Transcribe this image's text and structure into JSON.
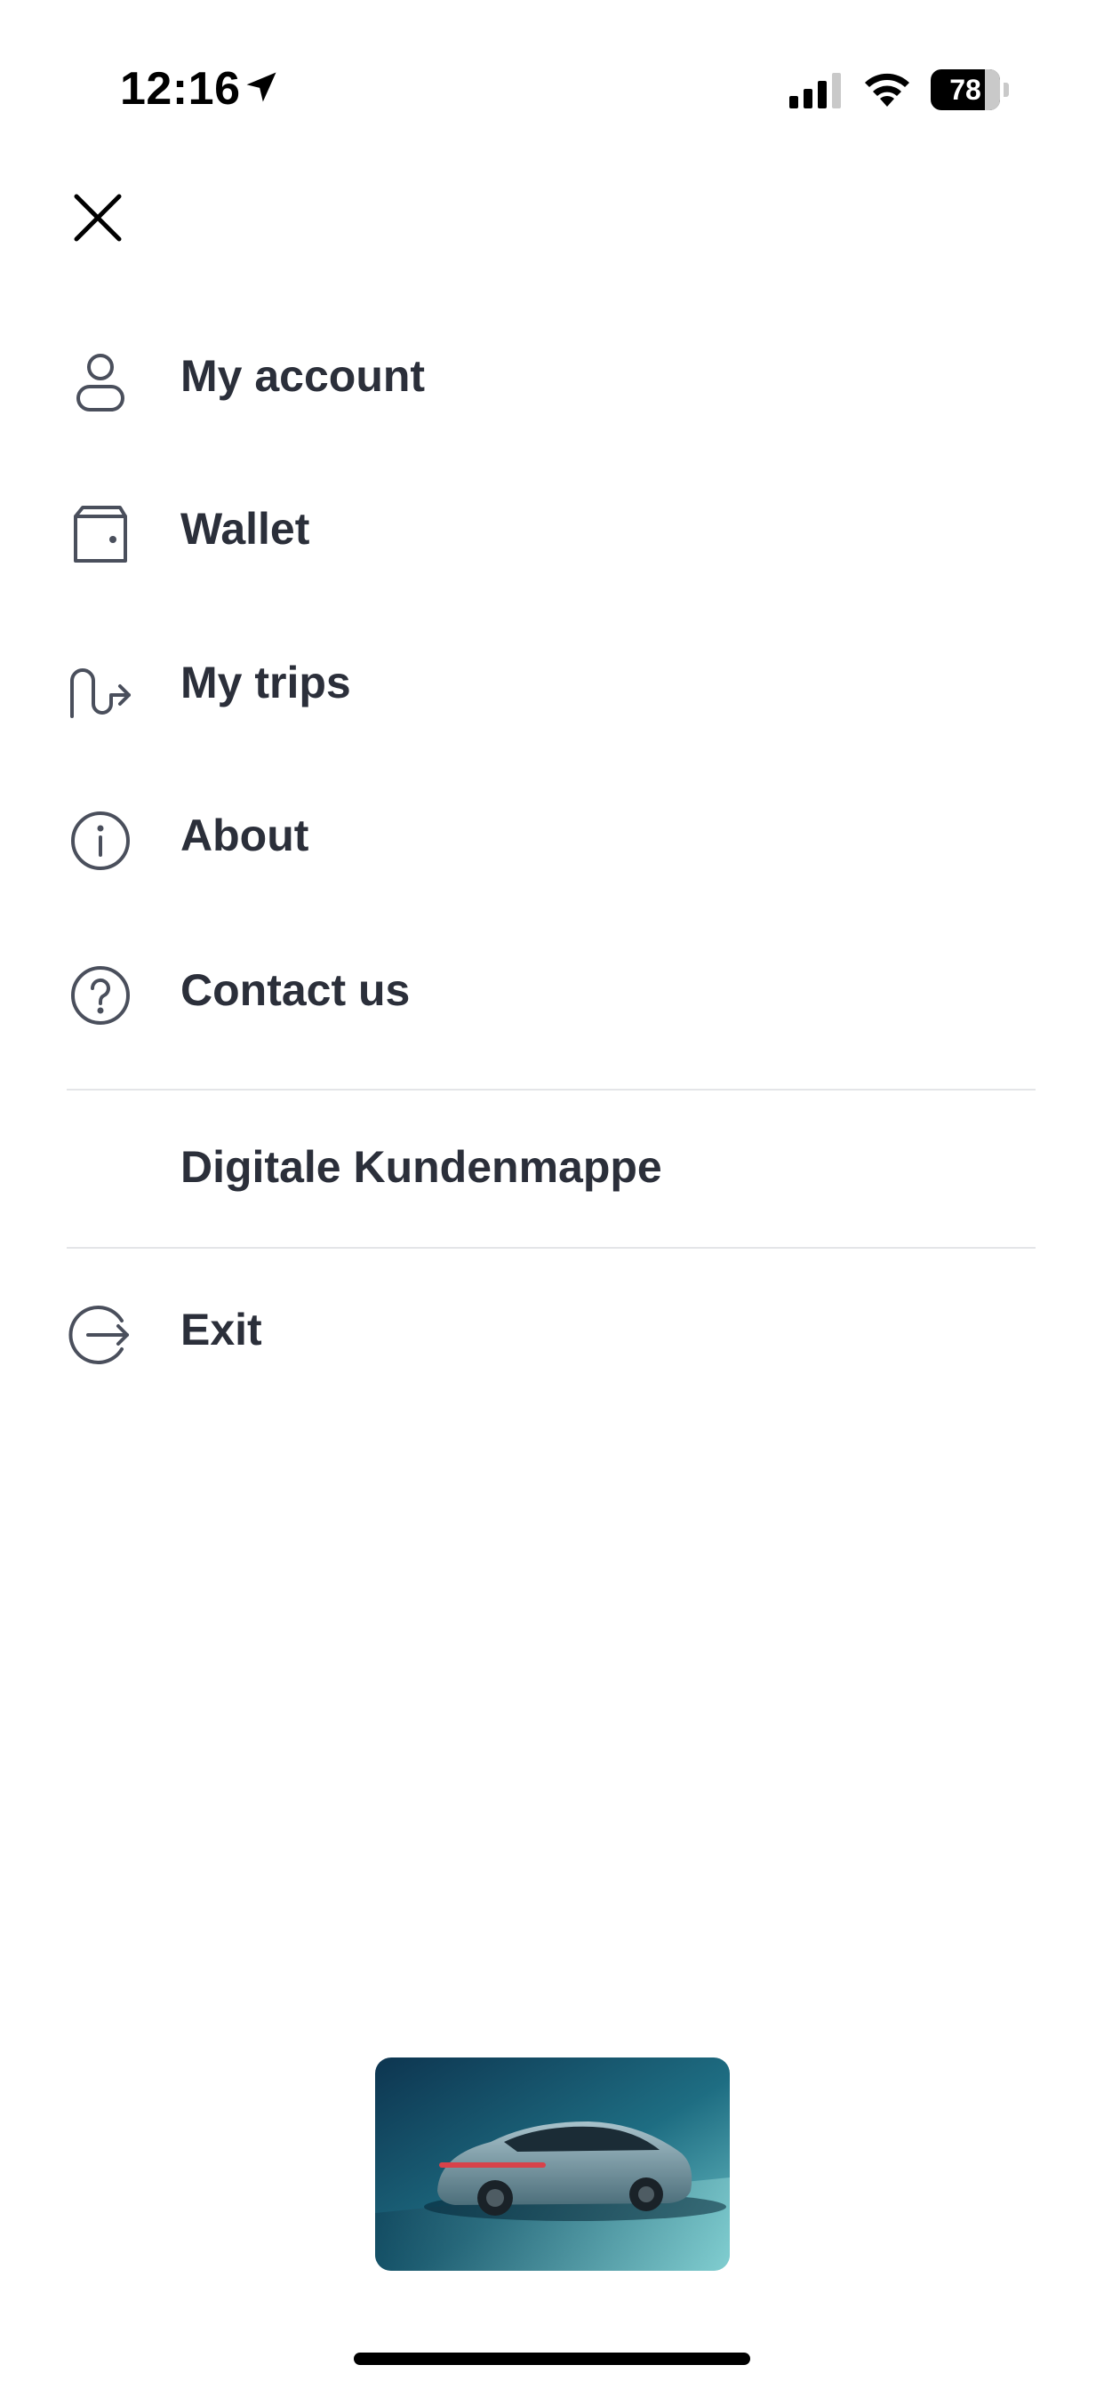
{
  "status_bar": {
    "time": "12:16",
    "battery_level": "78",
    "battery_fraction": 0.78,
    "icons": [
      "location-arrow-icon",
      "cellular-signal-icon",
      "wifi-icon",
      "battery-icon"
    ]
  },
  "header": {
    "close_icon": "close-icon"
  },
  "menu": {
    "items": [
      {
        "label": "My account",
        "icon": "user-icon"
      },
      {
        "label": "Wallet",
        "icon": "wallet-icon"
      },
      {
        "label": "My trips",
        "icon": "route-icon"
      },
      {
        "label": "About",
        "icon": "info-icon"
      },
      {
        "label": "Contact us",
        "icon": "help-icon"
      }
    ],
    "document_link": {
      "label": "Digitale Kundenmappe"
    },
    "exit": {
      "label": "Exit",
      "icon": "exit-icon"
    }
  },
  "colors": {
    "text": "#2b2f3a",
    "divider": "#e4e5e8",
    "background": "#ffffff"
  }
}
